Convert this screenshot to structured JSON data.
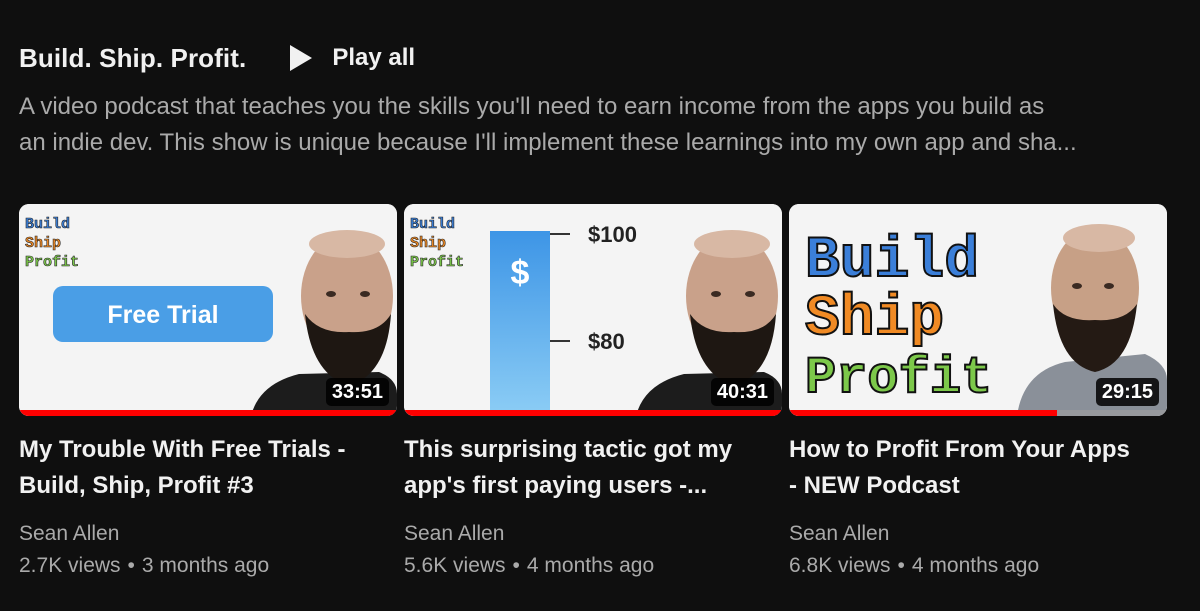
{
  "shelf": {
    "title": "Build. Ship. Profit.",
    "play_all_label": "Play all",
    "description_line1": "A video podcast that teaches you the skills you'll need to earn income from the apps you build as",
    "description_line2": "an indie dev. This show is unique because I'll implement these learnings into my own app and sha..."
  },
  "videos": [
    {
      "title_line1": "My Trouble With Free Trials -",
      "title_line2": "Build, Ship, Profit #3",
      "channel": "Sean Allen",
      "views": "2.7K views",
      "age": "3 months ago",
      "duration": "33:51",
      "watched_fraction": 1.0,
      "thumb_logo": [
        "Build",
        "Ship",
        "Profit"
      ],
      "thumb_button": "Free Trial"
    },
    {
      "title_line1": "This surprising tactic got my",
      "title_line2": "app's first paying users -...",
      "channel": "Sean Allen",
      "views": "5.6K views",
      "age": "4 months ago",
      "duration": "40:31",
      "watched_fraction": 1.0,
      "thumb_logo": [
        "Build",
        "Ship",
        "Profit"
      ],
      "thumb_labels": [
        "$100",
        "$80"
      ],
      "thumb_symbol": "$"
    },
    {
      "title_line1": "How to Profit From Your Apps",
      "title_line2": "- NEW Podcast",
      "channel": "Sean Allen",
      "views": "6.8K views",
      "age": "4 months ago",
      "duration": "29:15",
      "watched_fraction": 0.71,
      "thumb_logo": [
        "Build",
        "Ship",
        "Profit"
      ]
    }
  ],
  "colors": {
    "background": "#0f0f0f",
    "progress": "#ff0000",
    "logo_blue": "#3b7fd9",
    "logo_orange": "#f08a24",
    "logo_green": "#7cc84a"
  }
}
